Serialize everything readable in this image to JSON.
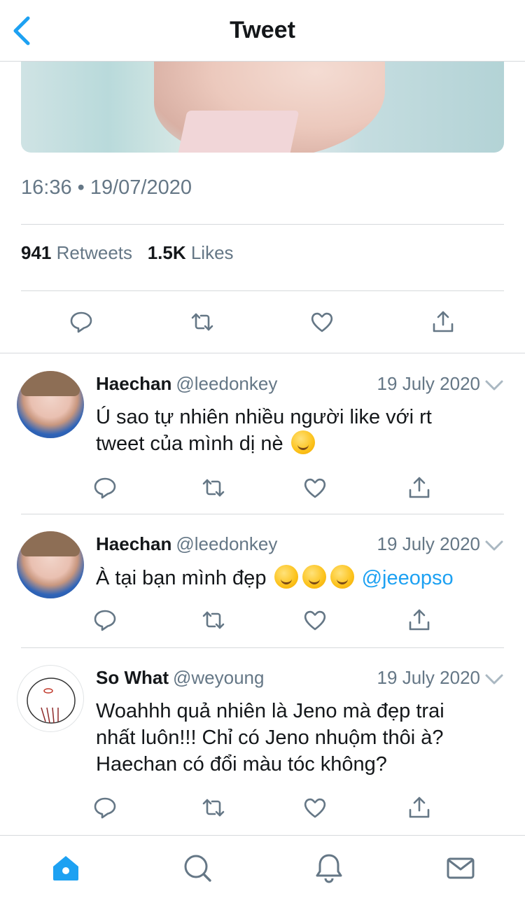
{
  "header": {
    "title": "Tweet"
  },
  "tweet": {
    "timestamp": "16:36 • 19/07/2020",
    "retweets_count": "941",
    "retweets_label": "Retweets",
    "likes_count": "1.5K",
    "likes_label": "Likes"
  },
  "replies": [
    {
      "name": "Haechan",
      "handle": "@leedonkey",
      "date": "19 July 2020",
      "text_line1": "Ú sao tự nhiên nhiều người like với rt",
      "text_line2": "tweet của mình dị nè",
      "emoji_name": "thinking-face-emoji"
    },
    {
      "name": "Haechan",
      "handle": "@leedonkey",
      "date": "19 July 2020",
      "text": "À tại bạn mình đẹp",
      "mention": "@jeeopso",
      "emoji_name": "rolling-on-floor-laughing-emoji"
    },
    {
      "name": "So What",
      "handle": "@weyoung",
      "date": "19 July 2020",
      "text_line1": "Woahhh quả nhiên là Jeno mà đẹp trai",
      "text_line2": "nhất luôn!!! Chỉ có Jeno nhuộm thôi à?",
      "text_line3": "Haechan có đổi màu tóc không?"
    }
  ],
  "icons": {
    "reply": "reply-icon",
    "retweet": "retweet-icon",
    "like": "heart-icon",
    "share": "share-icon"
  },
  "tabbar": {
    "tabs": [
      "home-icon",
      "search-icon",
      "notifications-icon",
      "messages-icon"
    ],
    "active_color": "#1da1f2",
    "inactive_color": "#657786"
  },
  "colors": {
    "accent": "#1da1f2",
    "secondary_text": "#657786",
    "divider": "#d6d9dc"
  }
}
